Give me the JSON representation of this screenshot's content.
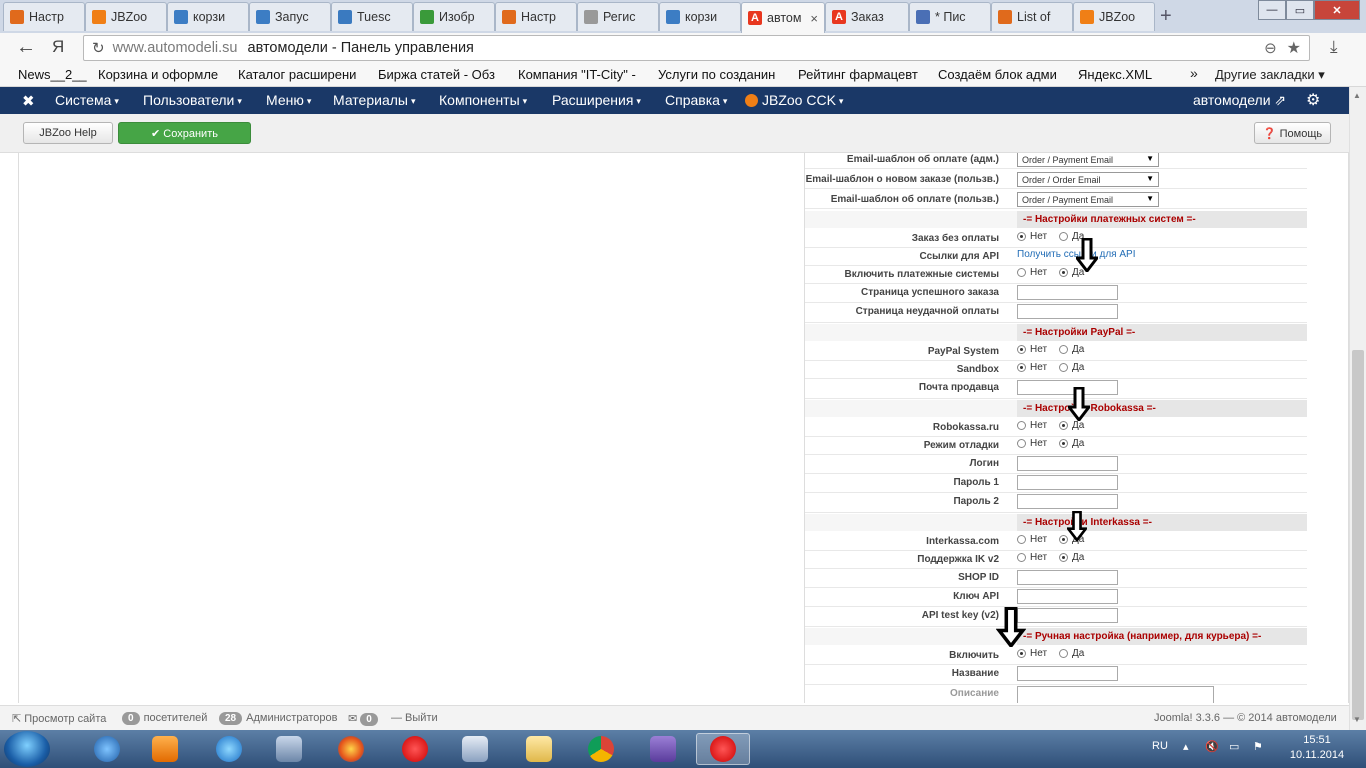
{
  "browser": {
    "tabs": [
      {
        "label": "Настр",
        "favicon": "joomla",
        "color": "#e06a1c"
      },
      {
        "label": "JBZoo",
        "favicon": "jbzoo",
        "color": "#f07f16"
      },
      {
        "label": "корзи",
        "favicon": "joomla",
        "color": "#3c7dc4"
      },
      {
        "label": "Запус",
        "favicon": "joomla",
        "color": "#3c7dc4"
      },
      {
        "label": "Tuesc",
        "favicon": "box",
        "color": "#3a7ac0"
      },
      {
        "label": "Изобр",
        "favicon": "image",
        "color": "#3a9a3a"
      },
      {
        "label": "Настр",
        "favicon": "joomla",
        "color": "#e06a1c"
      },
      {
        "label": "Регис",
        "favicon": "page",
        "color": "#999999"
      },
      {
        "label": "корзи",
        "favicon": "joomla",
        "color": "#3c7dc4"
      },
      {
        "label": "автом",
        "favicon": "A",
        "color": "#e8371f",
        "active": true
      },
      {
        "label": "Заказ",
        "favicon": "A",
        "color": "#e8371f"
      },
      {
        "label": "* Пис",
        "favicon": "mail",
        "color": "#4a6fb5"
      },
      {
        "label": "List of",
        "favicon": "joomla",
        "color": "#e06a1c"
      },
      {
        "label": "JBZoo",
        "favicon": "jbzoo",
        "color": "#f07f16"
      }
    ],
    "tab_close": "×",
    "new_tab": "+",
    "address": {
      "back": "←",
      "yandex_logo": "Я",
      "domain": "www.automodeli.su",
      "page_title": "автомодели - Панель управления",
      "reload": "↻",
      "zoom": "⊖",
      "star": "★",
      "download": "⤓"
    },
    "bookmarks": [
      "News__2__",
      "Корзина и оформле",
      "Каталог расширени",
      "Биржа статей - Обз",
      "Компания \"IT-City\" -",
      "Услуги по созданин",
      "Рейтинг фармацевт",
      "Создаём блок адми",
      "Яндекс.XML"
    ],
    "bookmarks_more": "»",
    "bookmarks_other": "Другие закладки ▾",
    "window_buttons": {
      "minimize": "—",
      "maximize": "▭",
      "close": "✕"
    }
  },
  "joomla_nav": {
    "logo": "✖",
    "menus": [
      "Система",
      "Пользователи",
      "Меню",
      "Материалы",
      "Компоненты",
      "Расширения",
      "Справка",
      "JBZoo CCK"
    ],
    "site_link": "автомодели ⇗",
    "gear": "⚙"
  },
  "toolbar": {
    "jbzoo_help": "JBZoo Help",
    "save": "✔ Сохранить",
    "help": "❓ Помощь"
  },
  "form": {
    "radio_no": "Нет",
    "radio_yes": "Да",
    "email_rows": [
      {
        "label": "Email-шаблон об оплате (адм.)",
        "value": "Order / Payment Email"
      },
      {
        "label": "Email-шаблон о новом заказе (пользв.)",
        "value": "Order / Order Email"
      },
      {
        "label": "Email-шаблон об оплате (пользв.)",
        "value": "Order / Payment Email"
      }
    ],
    "sec_payment": "-= Настройки платежных систем =-",
    "lbl_no_payment": "Заказ без оплаты",
    "lbl_api_links": "Ссылки для API",
    "api_link": "Получить ссылки для API",
    "lbl_enable_payment": "Включить платежные системы",
    "lbl_success_page": "Страница успешного заказа",
    "lbl_fail_page": "Страница неудачной оплаты",
    "sec_paypal": "-= Настройки PayPal =-",
    "lbl_paypal_system": "PayPal System",
    "lbl_sandbox": "Sandbox",
    "lbl_seller_email": "Почта продавца",
    "sec_robokassa": "-= Настройки Robokassa =-",
    "lbl_robokassa": "Robokassa.ru",
    "lbl_debug_mode": "Режим отладки",
    "lbl_login": "Логин",
    "lbl_password1": "Пароль 1",
    "lbl_password2": "Пароль 2",
    "sec_interkassa": "-= Настройки Interkassa =-",
    "lbl_interkassa": "Interkassa.com",
    "lbl_ik_v2": "Поддержка IK v2",
    "lbl_shop_id": "SHOP ID",
    "lbl_api_key": "Ключ API",
    "lbl_api_test_key": "API test key (v2)",
    "sec_manual": "-= Ручная настройка (например, для курьера) =-",
    "lbl_enable": "Включить",
    "lbl_name": "Название",
    "lbl_description": "Описание"
  },
  "statusbar": {
    "view_site": "⇱ Просмотр сайта",
    "visitors_count": "0",
    "visitors_label": "посетителей",
    "admins_count": "28",
    "admins_label": "Администраторов",
    "messages_count": "0",
    "logout": "— Выйти",
    "version": "Joomla! 3.3.6  —  © 2014 автомодели"
  },
  "taskbar": {
    "lang": "RU",
    "time": "15:51",
    "date": "10.11.2014"
  }
}
